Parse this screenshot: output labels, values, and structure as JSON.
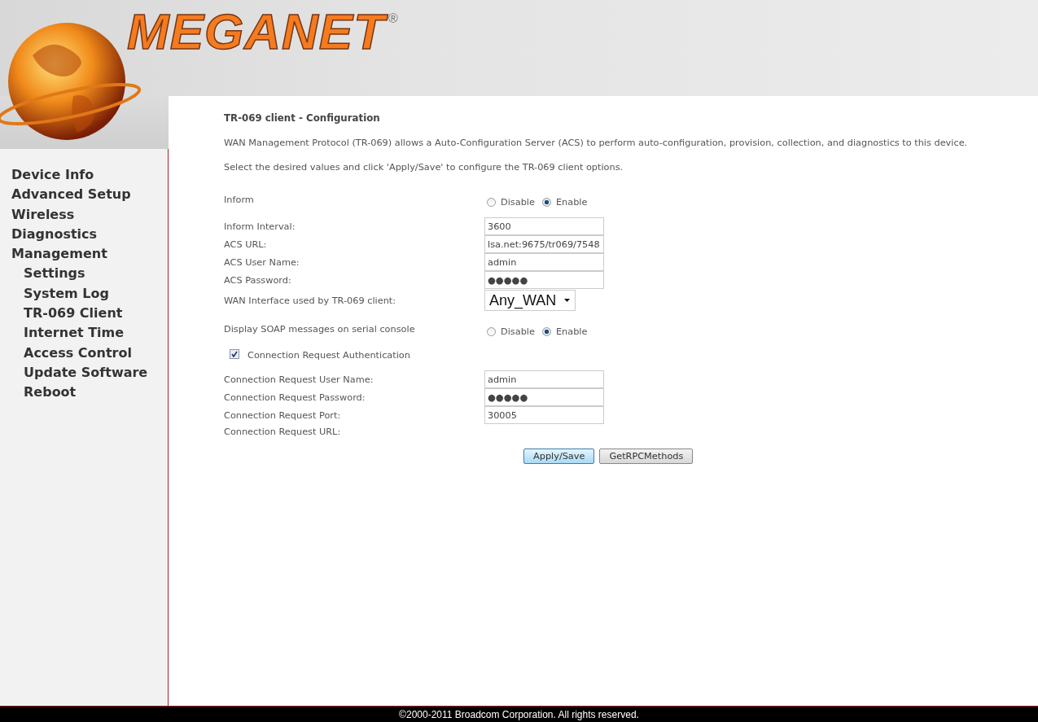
{
  "logo": {
    "text": "MEGANET",
    "mark": "®"
  },
  "nav": [
    {
      "label": "Device Info"
    },
    {
      "label": "Advanced Setup"
    },
    {
      "label": "Wireless"
    },
    {
      "label": "Diagnostics"
    },
    {
      "label": "Management",
      "children": [
        {
          "label": "Settings"
        },
        {
          "label": "System Log"
        },
        {
          "label": "TR-069 Client"
        },
        {
          "label": "Internet Time"
        },
        {
          "label": "Access Control"
        },
        {
          "label": "Update Software"
        },
        {
          "label": "Reboot"
        }
      ]
    }
  ],
  "title": "TR-069 client - Configuration",
  "intro": [
    "WAN Management Protocol (TR-069) allows a Auto-Configuration Server (ACS) to perform auto-configuration, provision, collection, and diagnostics to this device.",
    "Select the desired values and click 'Apply/Save' to configure the TR-069 client options."
  ],
  "rows": [
    {
      "kind": "radio",
      "label": "Inform",
      "options": [
        {
          "label": "Disable",
          "selected": false
        },
        {
          "label": "Enable",
          "selected": true
        }
      ]
    },
    {
      "kind": "input",
      "label": "Inform Interval:",
      "value": "3600"
    },
    {
      "kind": "input",
      "label": "ACS URL:",
      "value": "lsa.net:9675/tr069/7548"
    },
    {
      "kind": "input",
      "label": "ACS User Name:",
      "value": "admin"
    },
    {
      "kind": "input",
      "label": "ACS Password:",
      "value": "●●●●●"
    },
    {
      "kind": "select",
      "label": "WAN Interface used by TR-069 client:",
      "value": "Any_WAN"
    },
    {
      "kind": "radio",
      "label": "Display SOAP messages on serial console",
      "options": [
        {
          "label": "Disable",
          "selected": false
        },
        {
          "label": "Enable",
          "selected": true
        }
      ]
    },
    {
      "kind": "checkbox",
      "label": "Connection Request Authentication",
      "checked": true
    },
    {
      "kind": "input",
      "label": "Connection Request User Name:",
      "value": "admin"
    },
    {
      "kind": "input",
      "label": "Connection Request Password:",
      "value": "●●●●●"
    },
    {
      "kind": "input",
      "label": "Connection Request Port:",
      "value": "30005"
    },
    {
      "kind": "text",
      "label": "Connection Request URL:"
    }
  ],
  "buttons": [
    {
      "label": "Apply/Save",
      "primary": true
    },
    {
      "label": "GetRPCMethods",
      "primary": false
    }
  ],
  "footer": "©2000-2011 Broadcom Corporation. All rights reserved."
}
